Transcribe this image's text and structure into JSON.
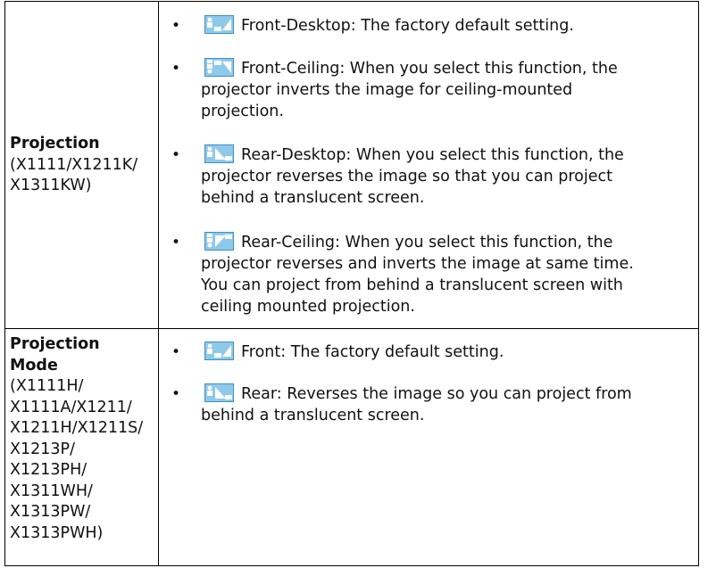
{
  "rows": [
    {
      "setting_name": "Projection",
      "models": [
        "(X1111/X1211K/",
        "X1311KW)"
      ],
      "options": [
        {
          "icon": "front-desktop-icon",
          "lines": [
            "Front-Desktop: The factory default setting."
          ]
        },
        {
          "icon": "front-ceiling-icon",
          "lines": [
            "Front-Ceiling: When you select this function, the",
            "projector inverts the image for ceiling-mounted",
            "projection."
          ]
        },
        {
          "icon": "rear-desktop-icon",
          "lines": [
            "Rear-Desktop: When you select this function, the",
            "projector reverses the image so that you can project",
            "behind a translucent screen."
          ]
        },
        {
          "icon": "rear-ceiling-icon",
          "lines": [
            "Rear-Ceiling: When you select this function, the",
            "projector reverses and inverts the image at same time.",
            "You can project from behind a translucent screen with",
            "ceiling mounted projection."
          ]
        }
      ]
    },
    {
      "setting_name": [
        "Projection",
        "Mode"
      ],
      "models": [
        "(X1111H/",
        "X1111A/X1211/",
        "X1211H/X1211S/",
        "X1213P/",
        "X1213PH/",
        "X1311WH/",
        "X1313PW/",
        "X1313PWH)"
      ],
      "options": [
        {
          "icon": "front-icon",
          "lines": [
            "Front: The factory default setting."
          ]
        },
        {
          "icon": "rear-icon",
          "lines": [
            "Rear: Reverses the image so you can project from",
            "behind a translucent screen."
          ]
        }
      ]
    }
  ],
  "bullet_char": "•",
  "icon_colors": {
    "fill": "#8fc9ea",
    "border": "#3f8fc6",
    "figure": "#ffffff"
  }
}
